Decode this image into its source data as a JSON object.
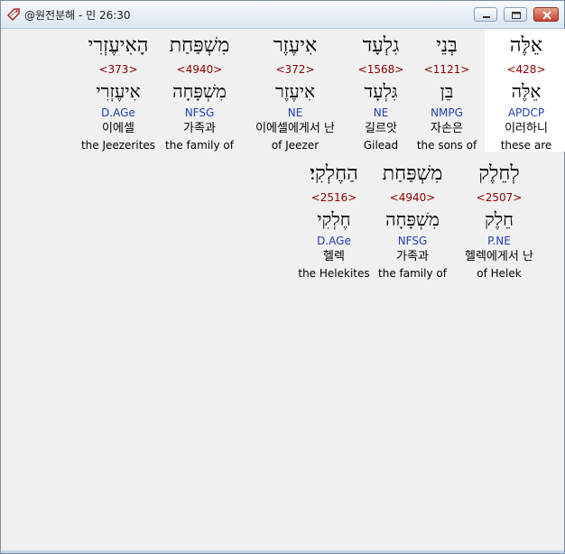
{
  "window": {
    "title": "@원전분해 - 민 26:30",
    "icons": {
      "app": "tag-icon",
      "minimize": "minimize-icon",
      "maximize": "maximize-icon",
      "close": "close-icon"
    }
  },
  "colors": {
    "strong": "#8b0000",
    "morph": "#1f3fb0",
    "highlight": "#ffffff"
  },
  "row1": [
    {
      "hebrew": "אֵלֶּה",
      "strong": "<428>",
      "lemma": "אֵלֶּה",
      "morph": "APDCP",
      "korean": "이러하니",
      "english": "these are"
    },
    {
      "hebrew": "בְּנֵי",
      "strong": "<1121>",
      "lemma": "בֵּן",
      "morph": "NMPG",
      "korean": "자손은",
      "english": "the sons of"
    },
    {
      "hebrew": "גִלְעָד",
      "strong": "<1568>",
      "lemma": "גִּלְעָד",
      "morph": "NE",
      "korean": "길르앗",
      "english": "Gilead"
    },
    {
      "hebrew": "אִיעֶזֶר",
      "strong": "<372>",
      "lemma": "אִיעֶזֶר",
      "morph": "NE",
      "korean": "이에셀에게서 난",
      "english": "of Jeezer"
    },
    {
      "hebrew": "מִשְׁפַּחַת",
      "strong": "<4940>",
      "lemma": "מִשְׁפָּחָה",
      "morph": "NFSG",
      "korean": "가족과",
      "english": "the family of"
    },
    {
      "hebrew": "הָאִיעֶזְרִי",
      "strong": "<373>",
      "lemma": "אִיעֶזְרִי",
      "morph": "D.AGe",
      "korean": "이에셀",
      "english": "the Jeezerites"
    }
  ],
  "row2": [
    {
      "hebrew": "לְחֵלֶק",
      "strong": "<2507>",
      "lemma": "חֵלֶק",
      "morph": "P.NE",
      "korean": "헬렉에게서 난",
      "english": "of Helek"
    },
    {
      "hebrew": "מִשְׁפַּחַת",
      "strong": "<4940>",
      "lemma": "מִשְׁפָּחָה",
      "morph": "NFSG",
      "korean": "가족과",
      "english": "the family of"
    },
    {
      "hebrew": "הַחֶלְקִי׃",
      "strong": "<2516>",
      "lemma": "חֶלְקִי",
      "morph": "D.AGe",
      "korean": "헬렉",
      "english": "the Helekites"
    }
  ]
}
